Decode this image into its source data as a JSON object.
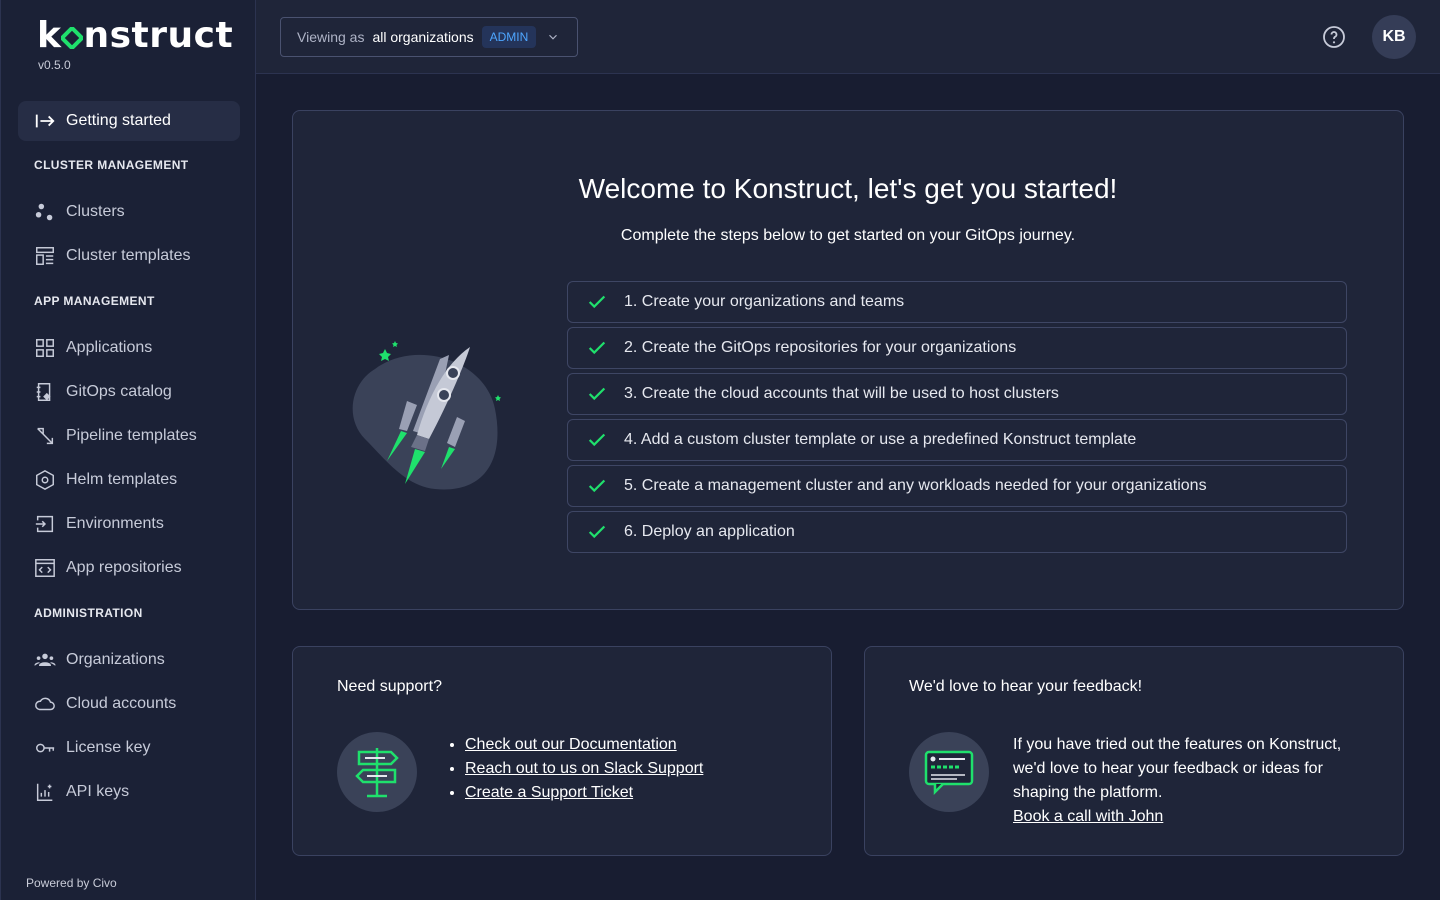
{
  "app": {
    "logo_text": "konstruct",
    "version": "v0.5.0",
    "powered_by": "Powered by Civo"
  },
  "sidebar": {
    "getting_started": "Getting started",
    "sections": {
      "cluster": "CLUSTER MANAGEMENT",
      "app": "APP MANAGEMENT",
      "admin": "ADMINISTRATION"
    },
    "items": [
      {
        "label": "Clusters",
        "icon": "clusters-icon"
      },
      {
        "label": "Cluster templates",
        "icon": "cluster-templates-icon"
      },
      {
        "label": "Applications",
        "icon": "applications-icon"
      },
      {
        "label": "GitOps catalog",
        "icon": "gitops-catalog-icon"
      },
      {
        "label": "Pipeline templates",
        "icon": "pipeline-templates-icon"
      },
      {
        "label": "Helm templates",
        "icon": "helm-icon"
      },
      {
        "label": "Environments",
        "icon": "environments-icon"
      },
      {
        "label": "App repositories",
        "icon": "app-repositories-icon"
      },
      {
        "label": "Organizations",
        "icon": "organizations-icon"
      },
      {
        "label": "Cloud accounts",
        "icon": "cloud-icon"
      },
      {
        "label": "License key",
        "icon": "key-icon"
      },
      {
        "label": "API keys",
        "icon": "api-keys-icon"
      }
    ]
  },
  "topbar": {
    "viewing_label": "Viewing as",
    "viewing_value": "all organizations",
    "role_badge": "ADMIN",
    "avatar_initials": "KB"
  },
  "main": {
    "title": "Welcome to Konstruct, let's get you started!",
    "subtitle": "Complete the steps below to get started on your GitOps journey.",
    "steps": [
      "1. Create your organizations and teams",
      "2. Create the GitOps repositories for your organizations",
      "3. Create the cloud accounts that will be used to host clusters",
      "4. Add a custom cluster template or use a predefined Konstruct template",
      "5. Create a management cluster and any workloads needed for your organizations",
      "6. Deploy an application"
    ]
  },
  "support": {
    "title": "Need support?",
    "links": [
      "Check out our Documentation",
      "Reach out to us on Slack Support",
      "Create a Support Ticket"
    ]
  },
  "feedback": {
    "title": "We'd love to hear your feedback!",
    "text": "If you have tried out the features on Konstruct, we'd love to hear your feedback or ideas for shaping the platform.",
    "link": "Book a call with John"
  },
  "colors": {
    "accent": "#1fe06c",
    "badge": "#4ea6ff",
    "background": "#181d31"
  }
}
